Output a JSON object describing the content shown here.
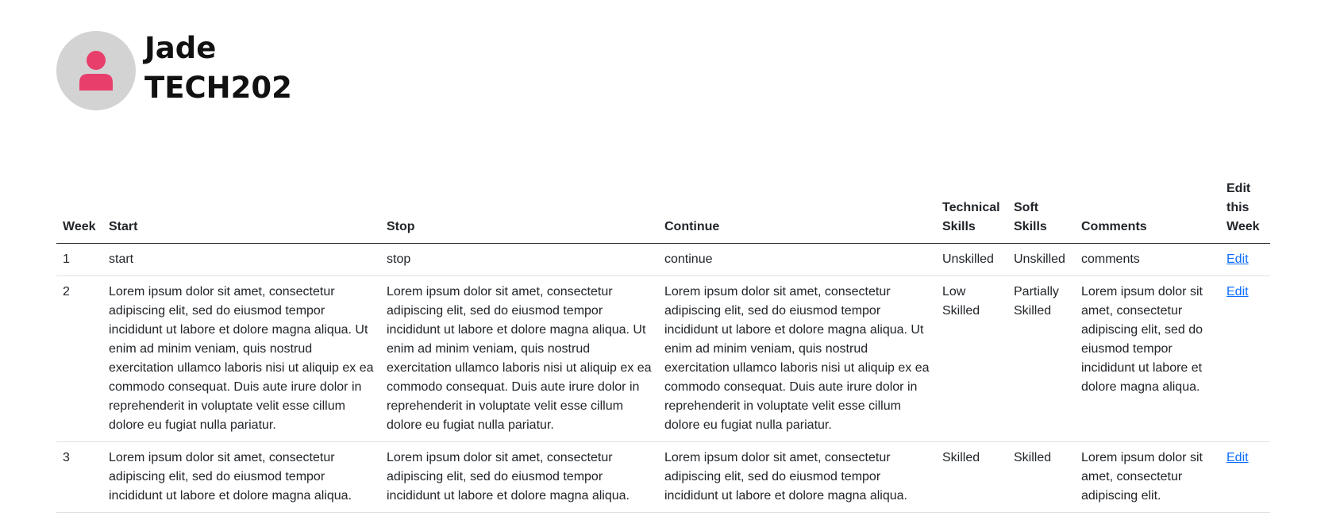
{
  "profile": {
    "name": "Jade",
    "course": "TECH202",
    "avatar_icon": "user-icon",
    "avatar_bg": "#d3d3d3",
    "avatar_icon_color": "#e83e6c"
  },
  "table": {
    "headers": {
      "week": "Week",
      "start": "Start",
      "stop": "Stop",
      "continue": "Continue",
      "technical": "Technical Skills",
      "soft": "Soft Skills",
      "comments": "Comments",
      "edit": "Edit this Week"
    },
    "rows": [
      {
        "week": "1",
        "start": "start",
        "stop": "stop",
        "continue": "continue",
        "technical": "Unskilled",
        "soft": "Unskilled",
        "comments": "comments",
        "edit": "Edit"
      },
      {
        "week": "2",
        "start": "Lorem ipsum dolor sit amet, consectetur adipiscing elit, sed do eiusmod tempor incididunt ut labore et dolore magna aliqua. Ut enim ad minim veniam, quis nostrud exercitation ullamco laboris nisi ut aliquip ex ea commodo consequat. Duis aute irure dolor in reprehenderit in voluptate velit esse cillum dolore eu fugiat nulla pariatur.",
        "stop": "Lorem ipsum dolor sit amet, consectetur adipiscing elit, sed do eiusmod tempor incididunt ut labore et dolore magna aliqua. Ut enim ad minim veniam, quis nostrud exercitation ullamco laboris nisi ut aliquip ex ea commodo consequat. Duis aute irure dolor in reprehenderit in voluptate velit esse cillum dolore eu fugiat nulla pariatur.",
        "continue": "Lorem ipsum dolor sit amet, consectetur adipiscing elit, sed do eiusmod tempor incididunt ut labore et dolore magna aliqua. Ut enim ad minim veniam, quis nostrud exercitation ullamco laboris nisi ut aliquip ex ea commodo consequat. Duis aute irure dolor in reprehenderit in voluptate velit esse cillum dolore eu fugiat nulla pariatur.",
        "technical": "Low Skilled",
        "soft": "Partially Skilled",
        "comments": "Lorem ipsum dolor sit amet, consectetur adipiscing elit, sed do eiusmod tempor incididunt ut labore et dolore magna aliqua.",
        "edit": "Edit"
      },
      {
        "week": "3",
        "start": "Lorem ipsum dolor sit amet, consectetur adipiscing elit, sed do eiusmod tempor incididunt ut labore et dolore magna aliqua.",
        "stop": "Lorem ipsum dolor sit amet, consectetur adipiscing elit, sed do eiusmod tempor incididunt ut labore et dolore magna aliqua.",
        "continue": "Lorem ipsum dolor sit amet, consectetur adipiscing elit, sed do eiusmod tempor incididunt ut labore et dolore magna aliqua.",
        "technical": "Skilled",
        "soft": "Skilled",
        "comments": "Lorem ipsum dolor sit amet, consectetur adipiscing elit.",
        "edit": "Edit"
      }
    ]
  }
}
